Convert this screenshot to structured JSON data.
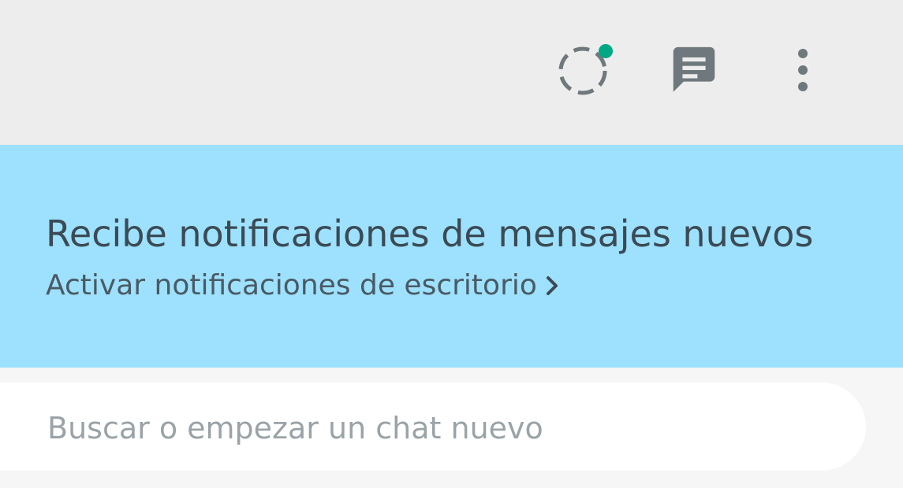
{
  "header": {
    "icons": {
      "status": "status-icon",
      "new_chat": "new-chat-icon",
      "menu": "menu-icon"
    },
    "status_dot_color": "#00a884",
    "icon_color": "#6f787d"
  },
  "banner": {
    "title": "Recibe notificaciones de mensajes nuevos",
    "link_label": "Activar notificaciones de escritorio",
    "background": "#9de1fe"
  },
  "search": {
    "placeholder": "Buscar o empezar un chat nuevo",
    "value": ""
  }
}
